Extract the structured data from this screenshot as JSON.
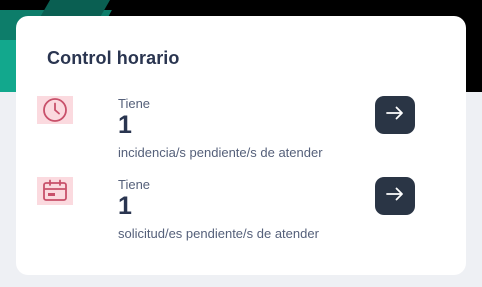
{
  "card": {
    "title": "Control horario"
  },
  "items": [
    {
      "icon": "clock-icon",
      "label": "Tiene",
      "count": "1",
      "description": "incidencia/s pendiente/s de atender",
      "action_icon": "arrow-right-icon"
    },
    {
      "icon": "calendar-icon",
      "label": "Tiene",
      "count": "1",
      "description": "solicitud/es pendiente/s de atender",
      "action_icon": "arrow-right-icon"
    }
  ],
  "colors": {
    "accent_icon": "#c8506a",
    "icon_bg": "#fbdadf",
    "button_bg": "#2a3545",
    "title": "#2a3550"
  }
}
